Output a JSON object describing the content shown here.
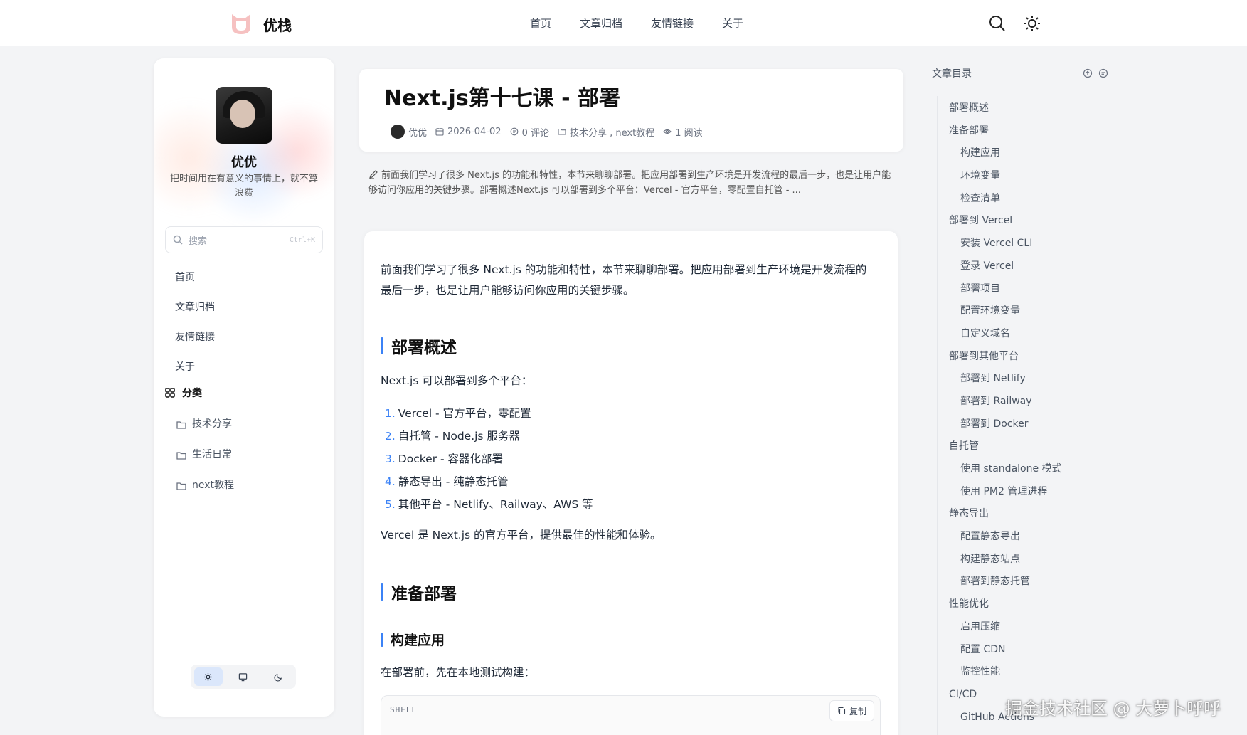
{
  "header": {
    "brand": "优栈",
    "nav": [
      "首页",
      "文章归档",
      "友情链接",
      "关于"
    ]
  },
  "icons": {
    "logo": "cat-logo-icon",
    "search": "search-icon",
    "theme": "sun-icon"
  },
  "sidebar": {
    "profile_name": "优优",
    "profile_bio": "把时间用在有意义的事情上，就不算浪费",
    "search_placeholder": "搜索",
    "search_shortcut": "Ctrl+K",
    "nav": [
      "首页",
      "文章归档",
      "友情链接",
      "关于"
    ],
    "categories_title": "分类",
    "categories": [
      "技术分享",
      "生活日常",
      "next教程"
    ],
    "theme_options": [
      "light",
      "system",
      "dark"
    ],
    "theme_active": "light"
  },
  "post": {
    "title": "Next.js第十七课 - 部署",
    "author": "优优",
    "date": "2026-04-02",
    "comments": "0 评论",
    "tags": "技术分享 , next教程",
    "views": "1 阅读",
    "summary": "前面我们学习了很多 Next.js 的功能和特性，本节来聊聊部署。把应用部署到生产环境是开发流程的最后一步，也是让用户能够访问你应用的关键步骤。部署概述Next.js 可以部署到多个平台：Vercel - 官方平台，零配置自托管 - ..."
  },
  "article": {
    "intro_line1": "前面我们学习了很多 Next.js 的功能和特性，本节来聊聊部署。把应用部署到生产环境是开发流程的",
    "intro_line2": "最后一步，也是让用户能够访问你应用的关键步骤。",
    "h2_overview": "部署概述",
    "overview_p": "Next.js 可以部署到多个平台：",
    "platforms": [
      {
        "num": "1.",
        "text": "Vercel - 官方平台，零配置"
      },
      {
        "num": "2.",
        "text": "自托管 - Node.js 服务器"
      },
      {
        "num": "3.",
        "text": "Docker - 容器化部署"
      },
      {
        "num": "4.",
        "text": "静态导出 - 纯静态托管"
      },
      {
        "num": "5.",
        "text": "其他平台 - Netlify、Railway、AWS 等"
      }
    ],
    "vercel_p": "Vercel 是 Next.js 的官方平台，提供最佳的性能和体验。",
    "h2_prepare": "准备部署",
    "h3_build": "构建应用",
    "build_p": "在部署前，先在本地测试构建：",
    "code_lang": "SHELL",
    "copy_label": "复制"
  },
  "toc": {
    "title": "文章目录",
    "items": [
      {
        "label": "部署概述",
        "level": 1
      },
      {
        "label": "准备部署",
        "level": 1
      },
      {
        "label": "构建应用",
        "level": 2
      },
      {
        "label": "环境变量",
        "level": 2
      },
      {
        "label": "检查清单",
        "level": 2
      },
      {
        "label": "部署到 Vercel",
        "level": 1
      },
      {
        "label": "安装 Vercel CLI",
        "level": 2
      },
      {
        "label": "登录 Vercel",
        "level": 2
      },
      {
        "label": "部署项目",
        "level": 2
      },
      {
        "label": "配置环境变量",
        "level": 2
      },
      {
        "label": "自定义域名",
        "level": 2
      },
      {
        "label": "部署到其他平台",
        "level": 1
      },
      {
        "label": "部署到 Netlify",
        "level": 2
      },
      {
        "label": "部署到 Railway",
        "level": 2
      },
      {
        "label": "部署到 Docker",
        "level": 2
      },
      {
        "label": "自托管",
        "level": 1
      },
      {
        "label": "使用 standalone 模式",
        "level": 2
      },
      {
        "label": "使用 PM2 管理进程",
        "level": 2
      },
      {
        "label": "静态导出",
        "level": 1
      },
      {
        "label": "配置静态导出",
        "level": 2
      },
      {
        "label": "构建静态站点",
        "level": 2
      },
      {
        "label": "部署到静态托管",
        "level": 2
      },
      {
        "label": "性能优化",
        "level": 1
      },
      {
        "label": "启用压缩",
        "level": 2
      },
      {
        "label": "配置 CDN",
        "level": 2
      },
      {
        "label": "监控性能",
        "level": 2
      },
      {
        "label": "CI/CD",
        "level": 1
      },
      {
        "label": "GitHub Actions",
        "level": 2
      }
    ]
  },
  "watermark": "掘金技术社区 @ 大萝卜呼呼",
  "colors": {
    "accent": "#3b82f6",
    "background": "#f3f4f6"
  }
}
